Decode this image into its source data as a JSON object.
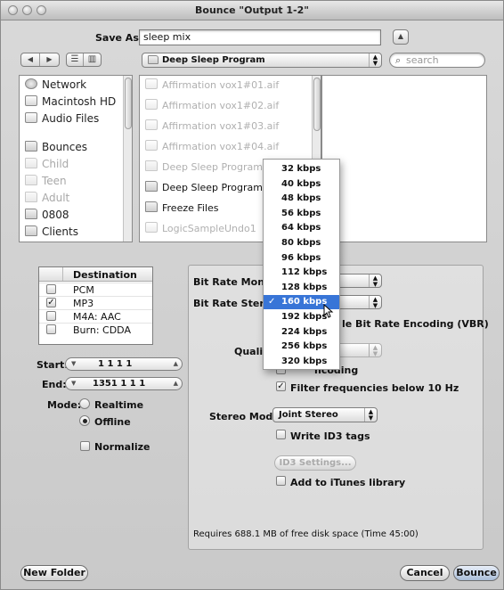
{
  "window": {
    "title": "Bounce \"Output 1-2\""
  },
  "save": {
    "label": "Save As:",
    "value": "sleep mix",
    "expand_glyph": "▲"
  },
  "nav": {
    "back_glyph": "◀",
    "forward_glyph": "▶",
    "list_view_glyph": "☰",
    "column_view_glyph": "▥",
    "location": "Deep Sleep Program",
    "search_placeholder": "search"
  },
  "sidebar": {
    "items": [
      {
        "label": "Network",
        "icon": "network-globe-icon",
        "dim": false
      },
      {
        "label": "Macintosh HD",
        "icon": "hard-drive-icon",
        "dim": false
      },
      {
        "label": "Audio Files",
        "icon": "drive-icon",
        "dim": false
      },
      {
        "label": "Bounces",
        "icon": "folder-icon",
        "dim": false
      },
      {
        "label": "Child",
        "icon": "folder-icon",
        "dim": true
      },
      {
        "label": "Teen",
        "icon": "folder-icon",
        "dim": true
      },
      {
        "label": "Adult",
        "icon": "folder-icon",
        "dim": true
      },
      {
        "label": "0808",
        "icon": "folder-icon",
        "dim": false
      },
      {
        "label": "Clients",
        "icon": "folder-icon",
        "dim": false
      }
    ]
  },
  "files": {
    "items": [
      {
        "label": "Affirmation vox1#01.aif",
        "dim": true
      },
      {
        "label": "Affirmation vox1#02.aif",
        "dim": true
      },
      {
        "label": "Affirmation vox1#03.aif",
        "dim": true
      },
      {
        "label": "Affirmation vox1#04.aif",
        "dim": true
      },
      {
        "label": "Deep Sleep Program",
        "dim": true
      },
      {
        "label": "Deep Sleep Program.",
        "dim": false
      },
      {
        "label": "Freeze Files",
        "dim": false
      },
      {
        "label": "LogicSampleUndo1",
        "dim": true
      }
    ]
  },
  "destination": {
    "header": "Destination",
    "rows": [
      {
        "label": "PCM",
        "checked": false,
        "mark": ""
      },
      {
        "label": "MP3",
        "checked": true,
        "mark": "✓"
      },
      {
        "label": "M4A: AAC",
        "checked": false,
        "mark": ""
      },
      {
        "label": "Burn: CDDA",
        "checked": false,
        "mark": ""
      }
    ]
  },
  "range": {
    "start_label": "Start:",
    "start_value": "1  1  1    1",
    "end_label": "End:",
    "end_value": "1351  1  1    1",
    "down_glyph": "▼",
    "up_glyph": "▲"
  },
  "mode": {
    "label": "Mode:",
    "realtime": "Realtime",
    "offline": "Offline",
    "selected": "Offline"
  },
  "normalize": {
    "label": "Normalize",
    "checked": false
  },
  "mp3_options": {
    "bit_rate_mono_label": "Bit Rate Mono",
    "bit_rate_stereo_label": "Bit Rate Stereo",
    "vbr_label": "Use Variable Bit Rate Encoding (VBR)",
    "vbr_visible": "le Bit Rate Encoding (VBR)",
    "quality_label": "Quality",
    "best_encoding_visible": "ncoding",
    "filter_label": "Filter frequencies below 10 Hz",
    "filter_checked": true,
    "stereo_mode_label": "Stereo Mode:",
    "stereo_mode_value": "Joint Stereo",
    "write_id3_label": "Write ID3 tags",
    "id3_settings_label": "ID3 Settings...",
    "itunes_label": "Add to iTunes library",
    "disk_space": "Requires 688.1 MB of free disk space  (Time 45:00)"
  },
  "bitrate_menu": {
    "options": [
      "32 kbps",
      "40 kbps",
      "48 kbps",
      "56 kbps",
      "64 kbps",
      "80 kbps",
      "96 kbps",
      "112 kbps",
      "128 kbps",
      "160 kbps",
      "192 kbps",
      "224 kbps",
      "256 kbps",
      "320 kbps"
    ],
    "selected": "160 kbps",
    "check_glyph": "✓"
  },
  "footer": {
    "new_folder": "New Folder",
    "cancel": "Cancel",
    "bounce": "Bounce"
  },
  "colors": {
    "menu_highlight": "#3875d7",
    "window_bg": "#d0d0d0"
  }
}
